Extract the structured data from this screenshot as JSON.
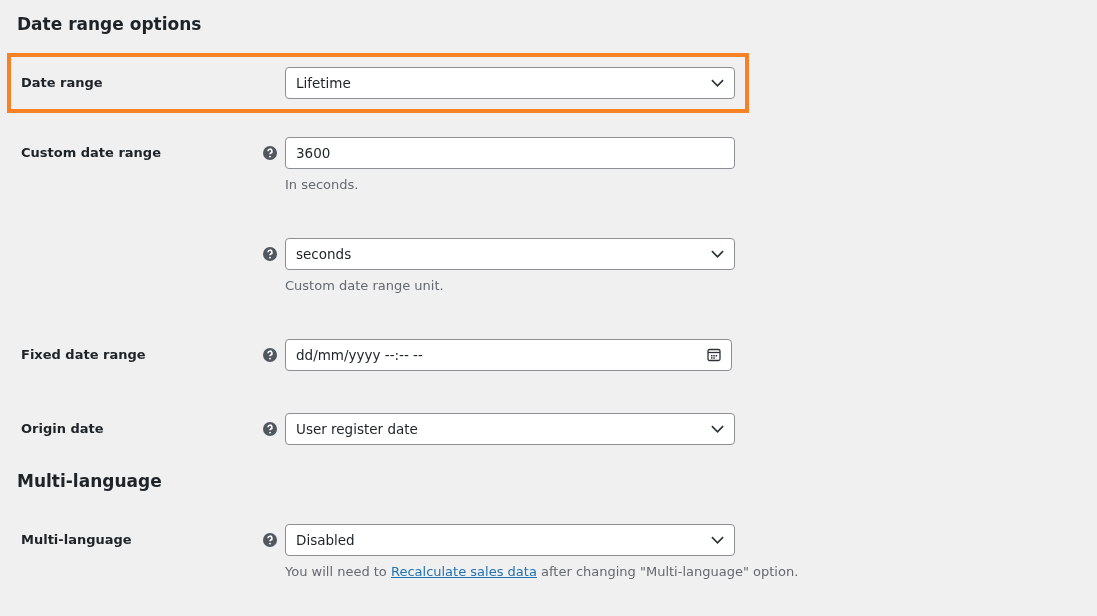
{
  "sections": [
    {
      "title": "Date range options",
      "rows": [
        {
          "label": "Date range",
          "help": false,
          "highlighted": true,
          "kind": "select",
          "value": "Lifetime",
          "description": []
        },
        {
          "label": "Custom date range",
          "help": true,
          "highlighted": false,
          "kind": "text",
          "value": "3600",
          "description": [
            {
              "kind": "text",
              "text": "In seconds."
            }
          ]
        },
        {
          "label": "",
          "help": true,
          "highlighted": false,
          "kind": "select",
          "value": "seconds",
          "description": [
            {
              "kind": "text",
              "text": "Custom date range unit."
            }
          ]
        },
        {
          "label": "Fixed date range",
          "help": true,
          "highlighted": false,
          "kind": "date",
          "value": "dd/mm/yyyy --:-- --",
          "description": []
        },
        {
          "label": "Origin date",
          "help": true,
          "highlighted": false,
          "kind": "select",
          "value": "User register date",
          "description": []
        }
      ]
    },
    {
      "title": "Multi-language",
      "rows": [
        {
          "label": "Multi-language",
          "help": true,
          "highlighted": false,
          "kind": "select",
          "value": "Disabled",
          "description": [
            {
              "kind": "text",
              "text": "You will need to "
            },
            {
              "kind": "link",
              "text": "Recalculate sales data"
            },
            {
              "kind": "text",
              "text": " after changing \"Multi-language\" option."
            }
          ]
        }
      ]
    }
  ]
}
